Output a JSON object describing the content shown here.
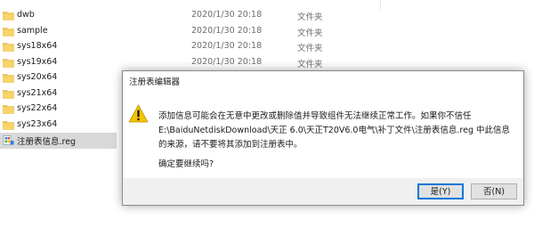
{
  "explorer": {
    "rows": [
      {
        "name": "dwb",
        "date": "2020/1/30 20:18",
        "type": "文件夹",
        "icon": "folder-icon"
      },
      {
        "name": "sample",
        "date": "2020/1/30 20:18",
        "type": "文件夹",
        "icon": "folder-icon"
      },
      {
        "name": "sys18x64",
        "date": "2020/1/30 20:18",
        "type": "文件夹",
        "icon": "folder-icon"
      },
      {
        "name": "sys19x64",
        "date": "2020/1/30 20:18",
        "type": "文件夹",
        "icon": "folder-icon"
      },
      {
        "name": "sys20x64",
        "date": "",
        "type": "",
        "icon": "folder-icon"
      },
      {
        "name": "sys21x64",
        "date": "",
        "type": "",
        "icon": "folder-icon"
      },
      {
        "name": "sys22x64",
        "date": "",
        "type": "",
        "icon": "folder-icon"
      },
      {
        "name": "sys23x64",
        "date": "",
        "type": "",
        "icon": "folder-icon"
      },
      {
        "name": "注册表信息.reg",
        "date": "",
        "type": "",
        "icon": "reg-file-icon",
        "selected": true
      }
    ]
  },
  "dialog": {
    "title": "注册表编辑器",
    "icon": "warning-icon",
    "message_line1": "添加信息可能会在无意中更改或删除值并导致组件无法继续正常工作。如果你不信任",
    "message_line2": "E:\\BaiduNetdiskDownload\\天正 6.0\\天正T20V6.0电气\\补丁文件\\注册表信息.reg 中此信息",
    "message_line3": "的来源，请不要将其添加到注册表中。",
    "confirm": "确定要继续吗?",
    "yes_label": "是(Y)",
    "no_label": "否(N)"
  },
  "colors": {
    "folder": "#f3c54a",
    "selection": "#d9d9d9",
    "dialog_footer": "#f0f0f0",
    "default_button_border": "#0078d7",
    "warning": "#f5c400"
  }
}
